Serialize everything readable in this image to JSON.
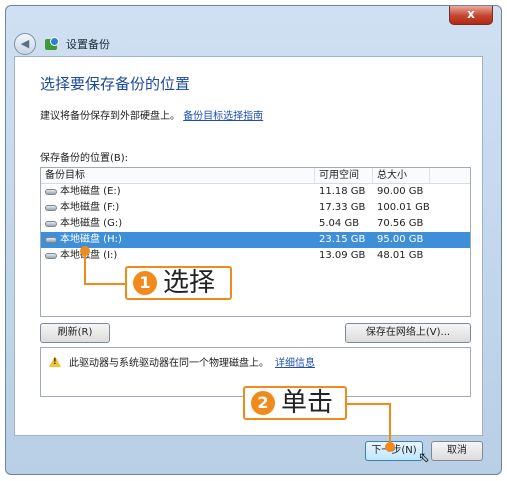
{
  "window": {
    "title": "设置备份",
    "close_label": "x"
  },
  "heading": "选择要保存备份的位置",
  "advice": {
    "text": "建议将备份保存到外部硬盘上。",
    "link": "备份目标选择指南"
  },
  "list_label": "保存备份的位置(B):",
  "columns": [
    "备份目标",
    "可用空间",
    "总大小"
  ],
  "rows": [
    {
      "name": "本地磁盘 (E:)",
      "free": "11.18 GB",
      "total": "90.00 GB",
      "selected": false
    },
    {
      "name": "本地磁盘 (F:)",
      "free": "17.33 GB",
      "total": "100.01 GB",
      "selected": false
    },
    {
      "name": "本地磁盘 (G:)",
      "free": "5.04 GB",
      "total": "70.56 GB",
      "selected": false
    },
    {
      "name": "本地磁盘 (H:)",
      "free": "23.15 GB",
      "total": "95.00 GB",
      "selected": true
    },
    {
      "name": "本地磁盘 (I:)",
      "free": "13.09 GB",
      "total": "48.01 GB",
      "selected": false
    }
  ],
  "buttons": {
    "refresh": "刷新(R)",
    "save_network": "保存在网络上(V)...",
    "next": "下一步(N)",
    "cancel": "取消"
  },
  "warning": {
    "text": "此驱动器与系统驱动器在同一个物理磁盘上。",
    "link": "详细信息"
  },
  "callouts": [
    {
      "num": "1",
      "text": "选择"
    },
    {
      "num": "2",
      "text": "单击"
    }
  ],
  "colors": {
    "accent": "#f08a1c",
    "selection": "#3f8fd8",
    "heading": "#1b4a9a",
    "link": "#1f4fb6"
  },
  "icons": {
    "back": "back-arrow-icon",
    "app": "backup-icon",
    "drive": "drive-icon",
    "warning": "warning-icon",
    "cursor": "mouse-pointer-icon"
  }
}
